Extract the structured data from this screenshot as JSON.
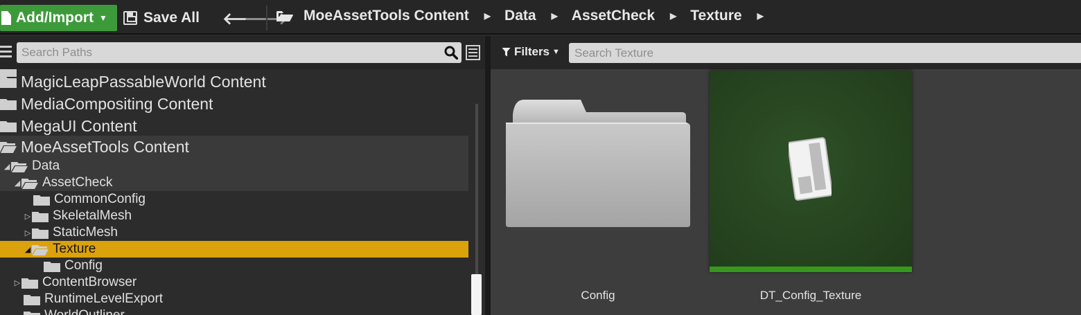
{
  "toolbar": {
    "add_import_label": "Add/Import",
    "save_all_label": "Save All",
    "breadcrumbs": [
      "MoeAssetTools Content",
      "Data",
      "AssetCheck",
      "Texture"
    ]
  },
  "left_panel": {
    "search_placeholder": "Search Paths",
    "tree": [
      {
        "label": "MagicLeapPassableWorld Content"
      },
      {
        "label": "MediaCompositing Content"
      },
      {
        "label": "MegaUI Content"
      },
      {
        "label": "MoeAssetTools Content"
      },
      {
        "label": "Data"
      },
      {
        "label": "AssetCheck"
      },
      {
        "label": "CommonConfig"
      },
      {
        "label": "SkeletalMesh"
      },
      {
        "label": "StaticMesh"
      },
      {
        "label": "Texture"
      },
      {
        "label": "Config"
      },
      {
        "label": "ContentBrowser"
      },
      {
        "label": "RuntimeLevelExport"
      },
      {
        "label": "WorldOutliner"
      }
    ]
  },
  "right_panel": {
    "filters_label": "Filters",
    "search_placeholder": "Search Texture",
    "assets": [
      {
        "name": "Config",
        "kind": "folder"
      },
      {
        "name": "DT_Config_Texture",
        "kind": "data-table"
      }
    ]
  },
  "colors": {
    "add_button": "#3d9a3a",
    "selection": "#dba20c",
    "asset_bg": "#26431f",
    "asset_bar": "#36981c"
  }
}
